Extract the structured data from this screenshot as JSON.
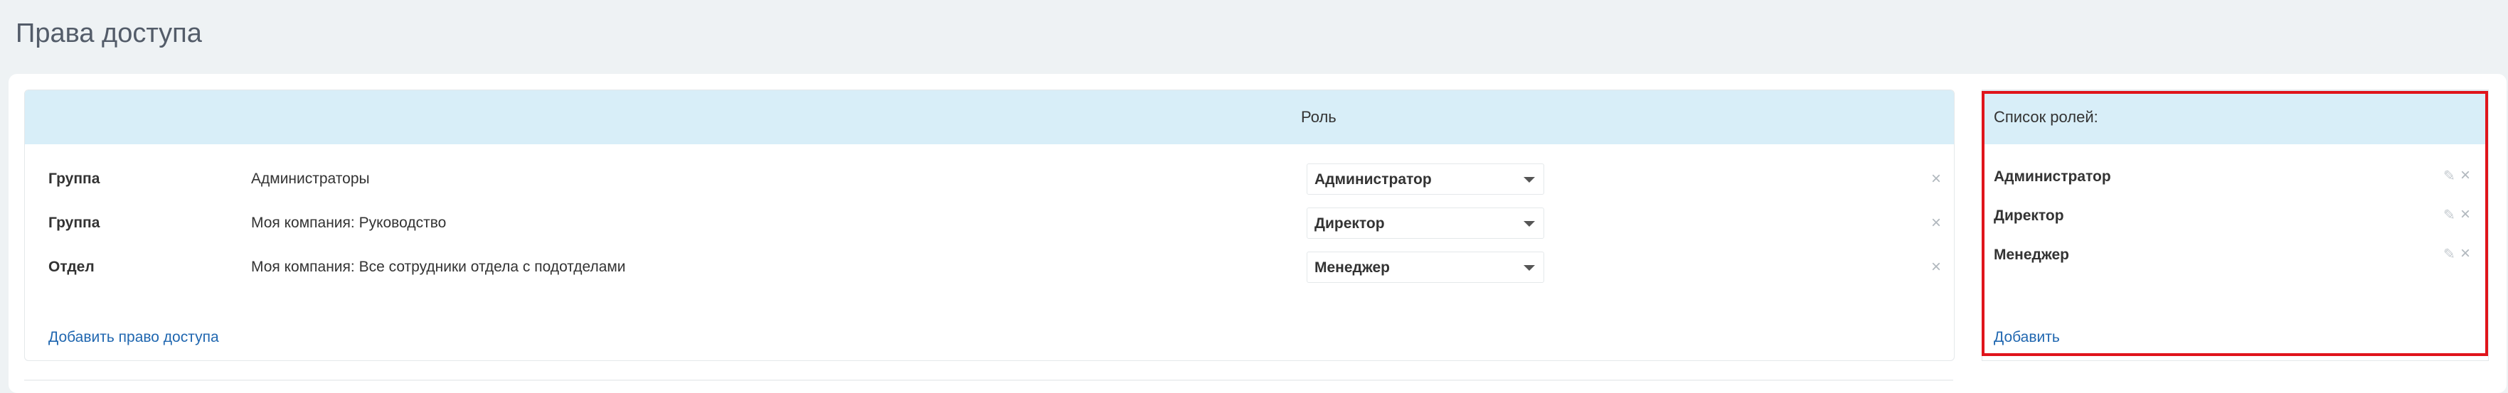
{
  "page": {
    "title": "Права доступа"
  },
  "main": {
    "header": {
      "role_column": "Роль"
    },
    "rows": [
      {
        "type": "Группа",
        "name": "Администраторы",
        "role": "Администратор"
      },
      {
        "type": "Группа",
        "name": "Моя компания: Руководство",
        "role": "Директор"
      },
      {
        "type": "Отдел",
        "name": "Моя компания: Все сотрудники отдела с подотделами",
        "role": "Менеджер"
      }
    ],
    "delete_icon": "×",
    "add_link": "Добавить право доступа"
  },
  "roles": {
    "title": "Список ролей:",
    "items": [
      {
        "label": "Администратор"
      },
      {
        "label": "Директор"
      },
      {
        "label": "Менеджер"
      }
    ],
    "edit_icon": "✎",
    "remove_icon": "×",
    "add_link": "Добавить"
  },
  "colors": {
    "header_bg": "#d8eef8",
    "link": "#2067b0",
    "highlight": "#e0141b"
  }
}
